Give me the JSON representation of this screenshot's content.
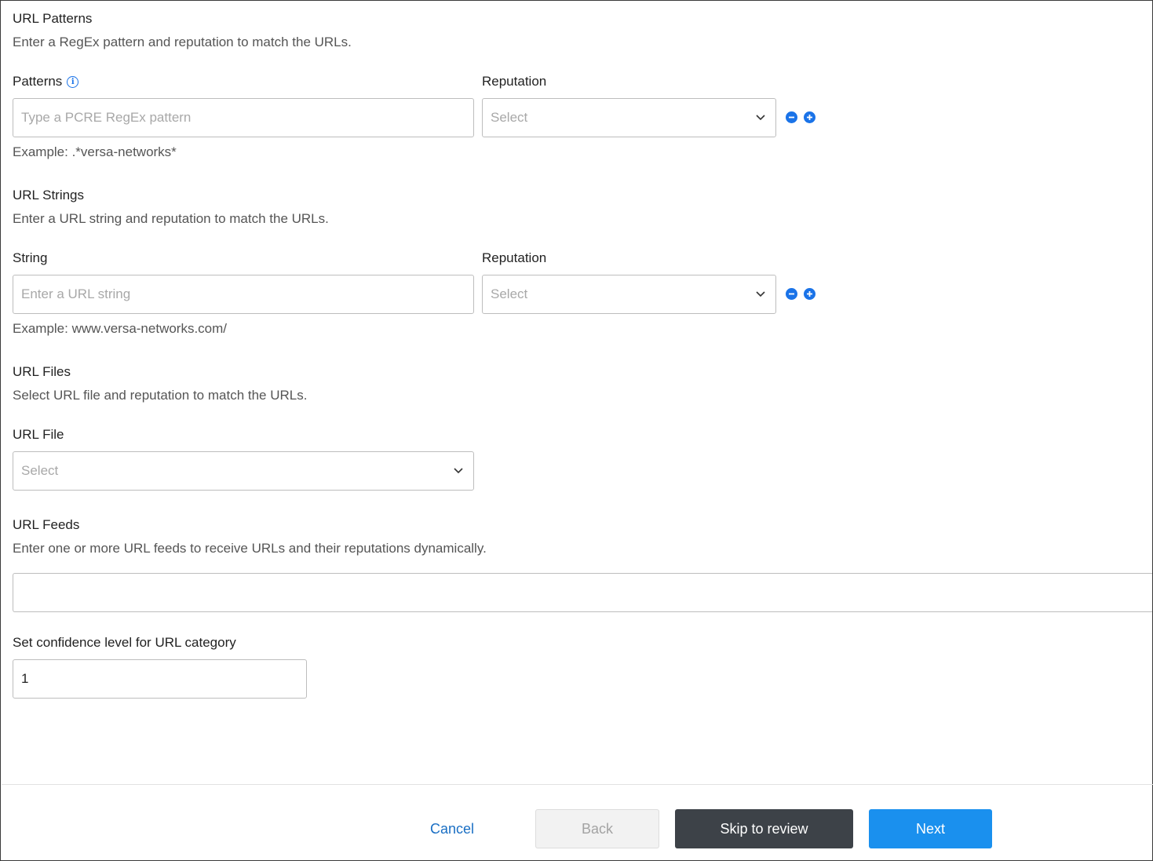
{
  "url_patterns": {
    "title": "URL Patterns",
    "description": "Enter a RegEx pattern and reputation to match the URLs.",
    "patterns_label": "Patterns",
    "patterns_placeholder": "Type a PCRE RegEx pattern",
    "reputation_label": "Reputation",
    "reputation_placeholder": "Select",
    "example": "Example: .*versa-networks*"
  },
  "url_strings": {
    "title": "URL Strings",
    "description": "Enter a URL string and reputation to match the URLs.",
    "string_label": "String",
    "string_placeholder": "Enter a URL string",
    "reputation_label": "Reputation",
    "reputation_placeholder": "Select",
    "example": "Example: www.versa-networks.com/"
  },
  "url_files": {
    "title": "URL Files",
    "description": "Select URL file and reputation to match the URLs.",
    "file_label": "URL File",
    "file_placeholder": "Select"
  },
  "url_feeds": {
    "title": "URL Feeds",
    "description": "Enter one or more URL feeds to receive URLs and their reputations dynamically.",
    "value": ""
  },
  "confidence": {
    "label": "Set confidence level for URL category",
    "value": "1"
  },
  "footer": {
    "cancel": "Cancel",
    "back": "Back",
    "skip": "Skip to review",
    "next": "Next"
  },
  "icons": {
    "info": "info-icon",
    "remove": "minus-circle-icon",
    "add": "plus-circle-icon",
    "dropdown": "chevron-down-icon"
  },
  "colors": {
    "accent": "#1a73e8",
    "next_button": "#1a90ee",
    "skip_button": "#3d4248",
    "link": "#1a6fc4"
  }
}
